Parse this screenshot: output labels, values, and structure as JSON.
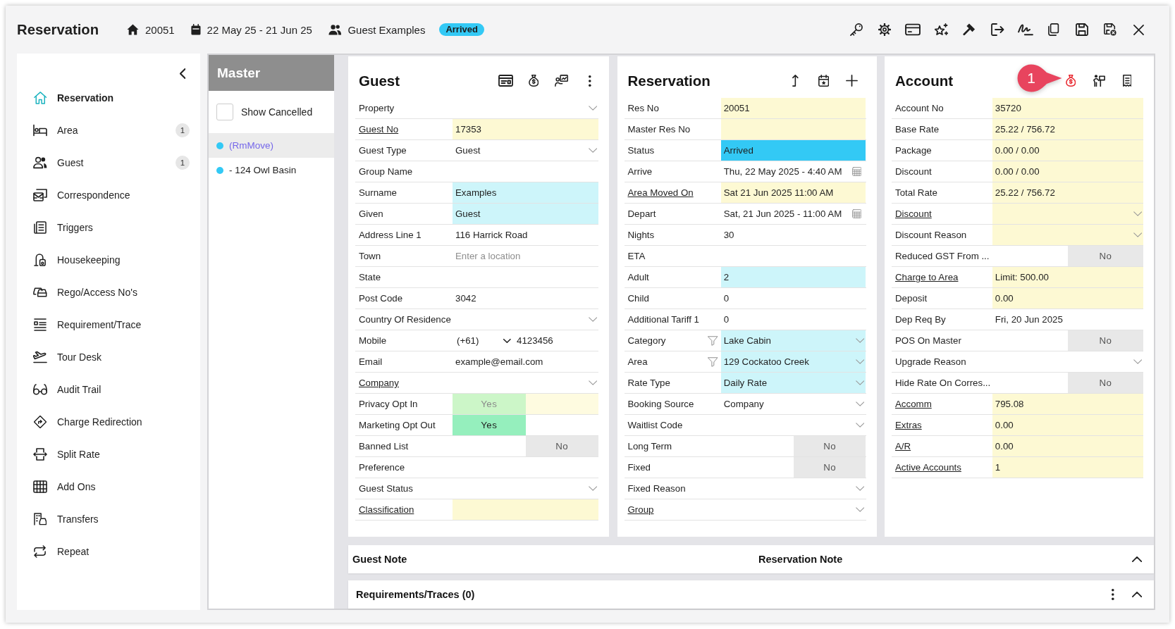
{
  "header": {
    "title": "Reservation",
    "res_no": "20051",
    "dates": "22 May 25 - 21 Jun 25",
    "guest_name": "Guest Examples",
    "status": {
      "label": "Arrived",
      "color": "#33c9f5"
    }
  },
  "sidebar": {
    "items": [
      {
        "label": "Reservation",
        "selected": true
      },
      {
        "label": "Area",
        "selected": false,
        "count": "1"
      },
      {
        "label": "Guest",
        "selected": false,
        "count": "1"
      },
      {
        "label": "Correspondence",
        "selected": false
      },
      {
        "label": "Triggers",
        "selected": false
      },
      {
        "label": "Housekeeping",
        "selected": false
      },
      {
        "label": "Rego/Access No's",
        "selected": false
      },
      {
        "label": "Requirement/Trace",
        "selected": false
      },
      {
        "label": "Tour Desk",
        "selected": false
      },
      {
        "label": "Audit Trail",
        "selected": false
      },
      {
        "label": "Charge Redirection",
        "selected": false
      },
      {
        "label": "Split Rate",
        "selected": false
      },
      {
        "label": "Add Ons",
        "selected": false
      },
      {
        "label": "Transfers",
        "selected": false
      },
      {
        "label": "Repeat",
        "selected": false
      }
    ]
  },
  "master": {
    "title": "Master",
    "show_cancelled": {
      "label": "Show Cancelled",
      "checked": false
    },
    "items": [
      {
        "label": "(RmMove)",
        "selected": true,
        "color": "#33c9f5"
      },
      {
        "label": "- 124 Owl Basin",
        "selected": false,
        "color": "#33c9f5"
      }
    ]
  },
  "panels": [
    {
      "title": "Guest",
      "rows": [
        {
          "label": "Property",
          "kind": "select",
          "link": false
        },
        {
          "label": "Guest No",
          "kind": "text",
          "link": true,
          "value": "17353",
          "color": "#fdf9d3"
        },
        {
          "label": "Guest Type",
          "kind": "select",
          "link": false,
          "value": "Guest"
        },
        {
          "label": "Group Name",
          "kind": "text",
          "link": false
        },
        {
          "label": "Surname",
          "kind": "text",
          "link": false,
          "value": "Examples",
          "color": "#cdf5fa"
        },
        {
          "label": "Given",
          "kind": "text",
          "link": false,
          "value": "Guest",
          "color": "#cdf5fa"
        },
        {
          "label": "Address Line 1",
          "kind": "text",
          "link": false,
          "value": "116 Harrick Road"
        },
        {
          "label": "Town",
          "kind": "text",
          "link": false,
          "placeholder": "Enter a location"
        },
        {
          "label": "State",
          "kind": "text",
          "link": false
        },
        {
          "label": "Post Code",
          "kind": "text",
          "link": false,
          "value": "3042"
        },
        {
          "label": "Country Of Residence",
          "kind": "select",
          "link": false
        },
        {
          "label": "Mobile",
          "kind": "phone",
          "link": false,
          "code": "(+61)",
          "value": "4123456"
        },
        {
          "label": "Email",
          "kind": "text",
          "link": false,
          "value": "example@email.com"
        },
        {
          "label": "Company",
          "kind": "select",
          "link": true
        },
        {
          "label": "Privacy Opt In",
          "kind": "toggle",
          "link": false,
          "value": "Yes",
          "on": true,
          "disabled": true,
          "color": "#fefbe0"
        },
        {
          "label": "Marketing Opt Out",
          "kind": "toggle",
          "link": false,
          "value": "Yes",
          "on": true,
          "disabled": false
        },
        {
          "label": "Banned List",
          "kind": "toggle",
          "link": false,
          "value": "No",
          "on": false,
          "disabled": false
        },
        {
          "label": "Preference",
          "kind": "text",
          "link": false
        },
        {
          "label": "Guest Status",
          "kind": "select",
          "link": false
        },
        {
          "label": "Classification",
          "kind": "text",
          "link": true,
          "color": "#fdf9d3"
        }
      ]
    },
    {
      "title": "Reservation",
      "rows": [
        {
          "label": "Res No",
          "kind": "text",
          "link": false,
          "value": "20051",
          "color": "#fdf9d3"
        },
        {
          "label": "Master Res No",
          "kind": "text",
          "link": false,
          "color": "#fdf9d3"
        },
        {
          "label": "Status",
          "kind": "text",
          "link": false,
          "value": "Arrived",
          "color": "#33c9f5"
        },
        {
          "label": "Arrive",
          "kind": "date",
          "link": false,
          "value": "Thu, 22 May 2025 - 4:40 AM"
        },
        {
          "label": "Area Moved On",
          "kind": "text",
          "link": true,
          "value": "Sat 21 Jun 2025 11:00 AM",
          "color": "#fdf9d3"
        },
        {
          "label": "Depart",
          "kind": "date",
          "link": false,
          "value": "Sat, 21 Jun 2025 - 11:00 AM"
        },
        {
          "label": "Nights",
          "kind": "text",
          "link": false,
          "value": "30"
        },
        {
          "label": "ETA",
          "kind": "text",
          "link": false
        },
        {
          "label": "Adult",
          "kind": "text",
          "link": false,
          "value": "2",
          "color": "#cdf5fa"
        },
        {
          "label": "Child",
          "kind": "text",
          "link": false,
          "value": "0"
        },
        {
          "label": "Additional Tariff 1",
          "kind": "text",
          "link": false,
          "value": "0"
        },
        {
          "label": "Category",
          "kind": "filtered",
          "link": false,
          "value": "Lake Cabin",
          "color": "#cdf5fa"
        },
        {
          "label": "Area",
          "kind": "filtered",
          "link": false,
          "value": "129 Cockatoo Creek",
          "color": "#cdf5fa"
        },
        {
          "label": "Rate Type",
          "kind": "select",
          "link": false,
          "value": "Daily Rate",
          "color": "#cdf5fa"
        },
        {
          "label": "Booking Source",
          "kind": "select",
          "link": false,
          "value": "Company"
        },
        {
          "label": "Waitlist Code",
          "kind": "select",
          "link": false
        },
        {
          "label": "Long Term",
          "kind": "toggle",
          "link": false,
          "value": "No",
          "on": false,
          "disabled": false
        },
        {
          "label": "Fixed",
          "kind": "toggle",
          "link": false,
          "value": "No",
          "on": false,
          "disabled": false
        },
        {
          "label": "Fixed Reason",
          "kind": "select",
          "link": false
        },
        {
          "label": "Group",
          "kind": "select",
          "link": true
        }
      ]
    },
    {
      "title": "Account",
      "callout": "1",
      "rows": [
        {
          "label": "Account No",
          "kind": "text",
          "link": false,
          "value": "35720",
          "color": "#fdf9d3"
        },
        {
          "label": "Base Rate",
          "kind": "text",
          "link": false,
          "value": "25.22 / 756.72",
          "color": "#fdf9d3"
        },
        {
          "label": "Package",
          "kind": "text",
          "link": false,
          "value": "0.00 / 0.00",
          "color": "#fdf9d3"
        },
        {
          "label": "Discount",
          "kind": "text",
          "link": false,
          "value": "0.00 / 0.00",
          "color": "#fdf9d3"
        },
        {
          "label": "Total Rate",
          "kind": "text",
          "link": false,
          "value": "25.22 / 756.72",
          "color": "#fdf9d3"
        },
        {
          "label": "Discount",
          "kind": "select",
          "link": true,
          "color": "#fdf9d3"
        },
        {
          "label": "Discount Reason",
          "kind": "select",
          "link": false,
          "color": "#fdf9d3"
        },
        {
          "label": "Reduced GST From ...",
          "kind": "toggle",
          "link": false,
          "value": "No",
          "on": false,
          "disabled": false
        },
        {
          "label": "Charge to Area",
          "kind": "text",
          "link": true,
          "value": "Limit: 500.00",
          "color": "#fdf9d3"
        },
        {
          "label": "Deposit",
          "kind": "text",
          "link": false,
          "value": "0.00",
          "color": "#fdf9d3"
        },
        {
          "label": "Dep Req By",
          "kind": "text",
          "link": false,
          "value": "Fri, 20 Jun 2025"
        },
        {
          "label": "POS On Master",
          "kind": "toggle",
          "link": false,
          "value": "No",
          "on": false,
          "disabled": false
        },
        {
          "label": "Upgrade Reason",
          "kind": "select",
          "link": false
        },
        {
          "label": "Hide Rate On Corres...",
          "kind": "toggle",
          "link": false,
          "value": "No",
          "on": false,
          "disabled": false
        },
        {
          "label": "Accomm",
          "kind": "text",
          "link": true,
          "value": "795.08",
          "color": "#fdf9d3"
        },
        {
          "label": "Extras",
          "kind": "text",
          "link": true,
          "value": "0.00",
          "color": "#fdf9d3"
        },
        {
          "label": "A/R",
          "kind": "text",
          "link": true,
          "value": "0.00",
          "color": "#fdf9d3"
        },
        {
          "label": "Active Accounts",
          "kind": "text",
          "link": true,
          "value": "1",
          "color": "#fdf9d3"
        }
      ]
    }
  ],
  "notes_bar": {
    "guest_note": "Guest Note",
    "reservation_note": "Reservation Note",
    "expanded": true
  },
  "requirements_bar": {
    "title": "Requirements/Traces (0)",
    "expanded": true
  }
}
